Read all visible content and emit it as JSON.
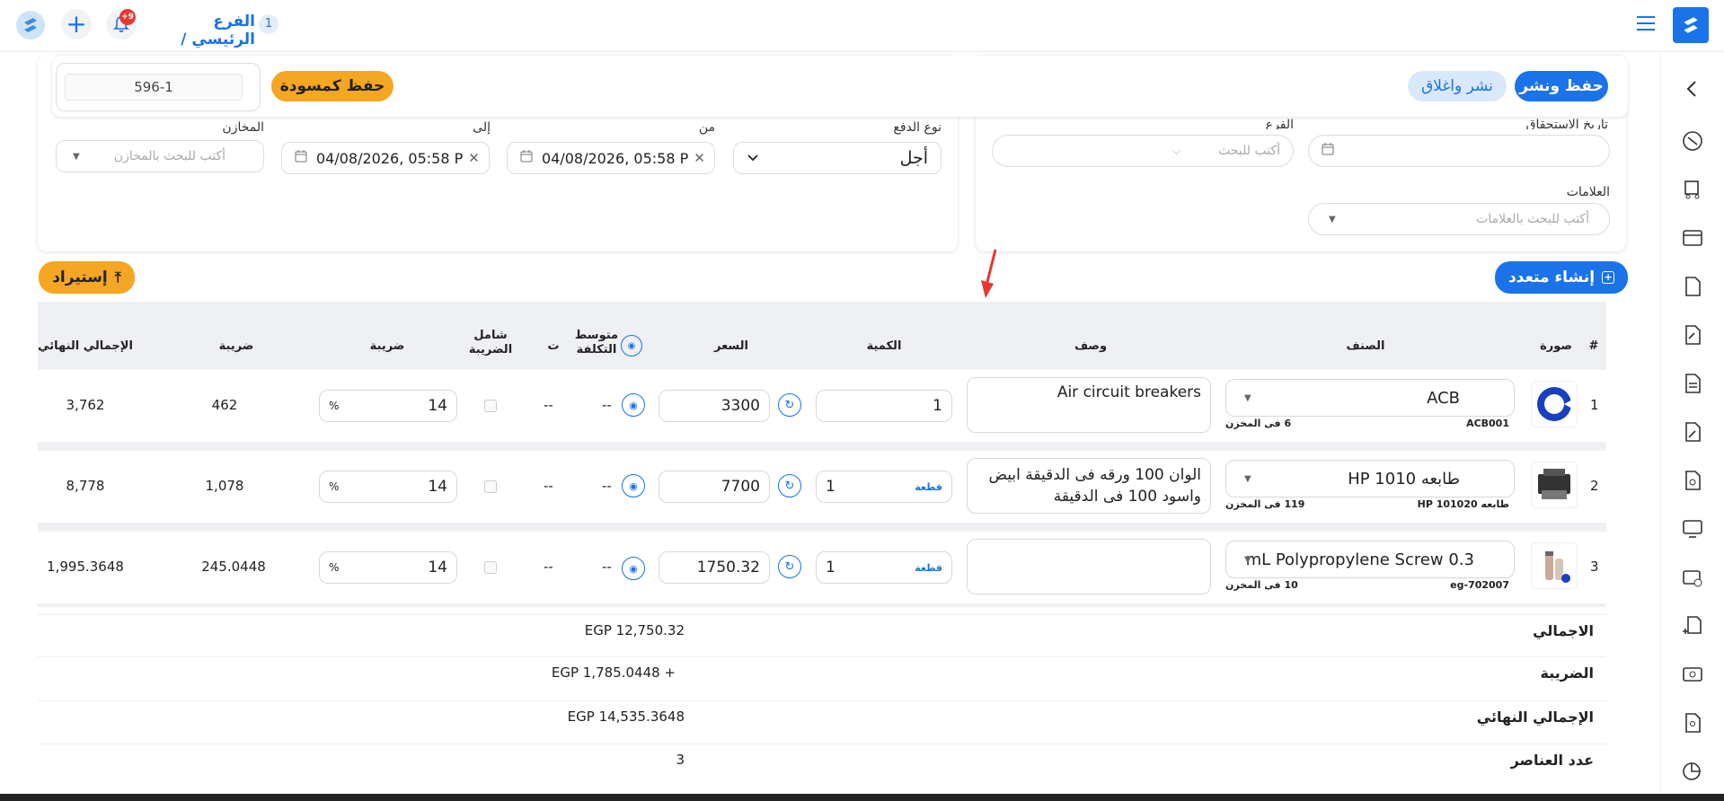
{
  "header": {
    "breadcrumb": "الفرع الرئيسي /",
    "branch_count": "1",
    "notification_badge": "+9"
  },
  "actions": {
    "save_publish": "حفظ ونشر",
    "publish_close": "نشر واغلاق",
    "save_draft": "حفظ كمسودة",
    "doc_number": "596-1"
  },
  "filters": {
    "due_date_label": "تاريخ الاستحقاق",
    "branch_label": "الفرع",
    "branch_placeholder": "أكتب للبحث",
    "tags_label": "العلامات",
    "tags_placeholder": "أكتب للبحث بالعلامات",
    "payment_label": "نوع الدفع",
    "payment_value": "أجل",
    "from_label": "من",
    "from_value": "04/08/2026, 05:58 P",
    "to_label": "إلى",
    "to_value": "04/08/2026, 05:58 P",
    "warehouses_label": "المخازن",
    "warehouses_placeholder": "أكتب للبحث بالمخازن"
  },
  "buttons": {
    "create_multiple": "إنشاء متعدد",
    "import": "إستيراد"
  },
  "table": {
    "headers": {
      "num": "#",
      "image": "صورة",
      "item": "الصنف",
      "desc": "وصف",
      "qty": "الكمية",
      "price": "السعر",
      "avg_cost": "متوسط التكلفة",
      "t": "ت",
      "tax_incl": "شامل الضريبة",
      "tax": "ضريبة",
      "tax2": "ضريبة",
      "final": "الإجمالي النهائي"
    },
    "rows": [
      {
        "num": "1",
        "item": "ACB",
        "code": "ACB001",
        "stock": "6 فى المخزن",
        "desc": "Air circuit breakers",
        "qty": "1",
        "unit": "",
        "price": "3300",
        "avg": "--",
        "t": "--",
        "tax_pct": "14",
        "pct": "%",
        "tax": "462",
        "final": "3,762"
      },
      {
        "num": "2",
        "item": "طابعه HP 1010",
        "code": "طابعه HP 101020",
        "stock": "119 فى المخزن",
        "desc": "الوان 100 ورقه فى الدقيقة ابيض واسود 100 فى الدقيقة",
        "qty": "1",
        "unit": "قطعة",
        "price": "7700",
        "avg": "--",
        "t": "--",
        "tax_pct": "14",
        "pct": "%",
        "tax": "1,078",
        "final": "8,778"
      },
      {
        "num": "3",
        "item": "mL Polypropylene Screw 0.3",
        "code": "eg-702007",
        "stock": "10 فى المخزن",
        "desc": "",
        "qty": "1",
        "unit": "قطعة",
        "price": "1750.32",
        "avg": "--",
        "t": "--",
        "tax_pct": "14",
        "pct": "%",
        "tax": "245.0448",
        "final": "1,995.3648"
      }
    ]
  },
  "summary": {
    "total_label": "الاجمالي",
    "total_value": "EGP 12,750.32",
    "tax_label": "الضريبة",
    "tax_value": "EGP 1,785.0448 +",
    "final_label": "الإجمالي النهائي",
    "final_value": "EGP 14,535.3648",
    "count_label": "عدد العناصر",
    "count_value": "3"
  },
  "colors": {
    "primary": "#1a73e8",
    "accent": "#f5a623"
  }
}
